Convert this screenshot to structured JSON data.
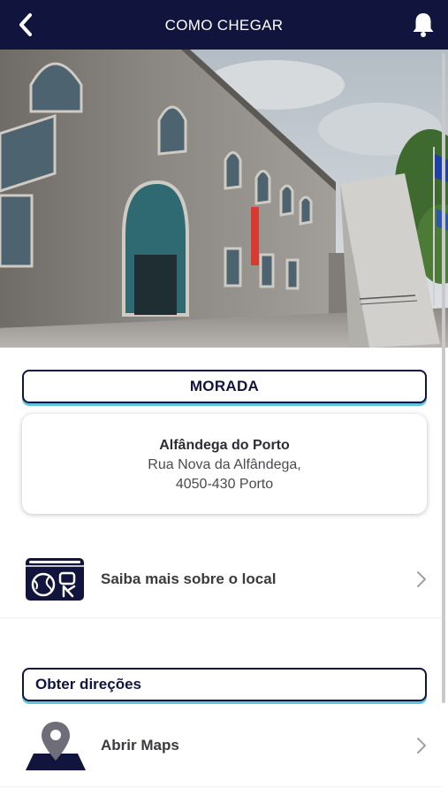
{
  "header": {
    "title": "COMO CHEGAR",
    "back_icon": "back-chevron-icon",
    "bell_icon": "bell-icon",
    "background_color": "#11143c"
  },
  "hero": {
    "image": "building-photo"
  },
  "morada": {
    "title": "MORADA",
    "place_name": "Alfândega do Porto",
    "address_line1": "Rua Nova da Alfândega,",
    "address_line2": "4050-430 Porto"
  },
  "info_link": {
    "label": "Saiba mais sobre o local",
    "icon": "web-browser-icon"
  },
  "directions": {
    "title": "Obter direções",
    "maps_label": "Abrir Maps",
    "maps_icon": "map-pin-icon"
  },
  "colors": {
    "navy": "#11143c",
    "accent": "#62c3de"
  }
}
